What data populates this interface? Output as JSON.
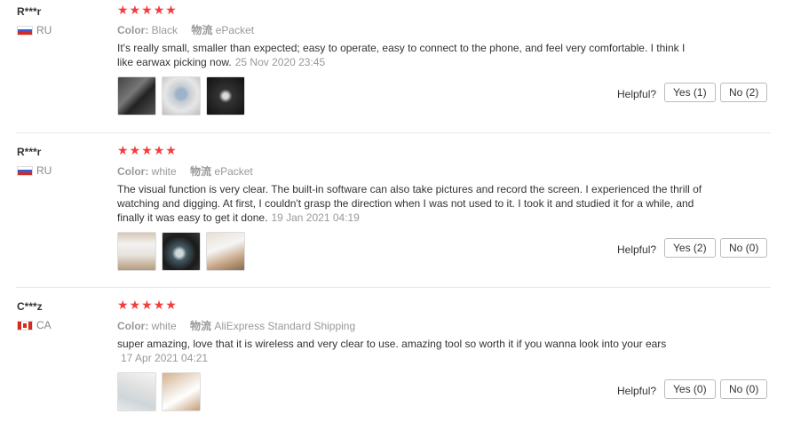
{
  "helpful_label": "Helpful?",
  "colors": {
    "star": "#f23d3d",
    "muted": "#999999"
  },
  "reviews": [
    {
      "user": "R***r",
      "country": "RU",
      "rating": 5,
      "color_label": "Color:",
      "color_value": "Black",
      "shipping_label": "物流",
      "shipping_value": "ePacket",
      "text": "It's really small, smaller than expected; easy to operate, easy to connect to the phone, and feel very comfortable. I think I like earwax picking now.",
      "date": "25 Nov 2020 23:45",
      "photo_count": 3,
      "yes_label": "Yes (1)",
      "no_label": "No (2)"
    },
    {
      "user": "R***r",
      "country": "RU",
      "rating": 5,
      "color_label": "Color:",
      "color_value": "white",
      "shipping_label": "物流",
      "shipping_value": "ePacket",
      "text": "The visual function is very clear. The built-in software can also take pictures and record the screen. I experienced the thrill of watching and digging. At first, I couldn't grasp the direction when I was not used to it. I took it and studied it for a while, and finally it was easy to get it done.",
      "date": "19 Jan 2021 04:19",
      "photo_count": 3,
      "yes_label": "Yes (2)",
      "no_label": "No (0)"
    },
    {
      "user": "C***z",
      "country": "CA",
      "rating": 5,
      "color_label": "Color:",
      "color_value": "white",
      "shipping_label": "物流",
      "shipping_value": "AliExpress Standard Shipping",
      "text": "super amazing, love that it is wireless and very clear to use. amazing tool so worth it if you wanna look into your ears",
      "date": "17 Apr 2021 04:21",
      "photo_count": 2,
      "yes_label": "Yes (0)",
      "no_label": "No (0)"
    }
  ]
}
